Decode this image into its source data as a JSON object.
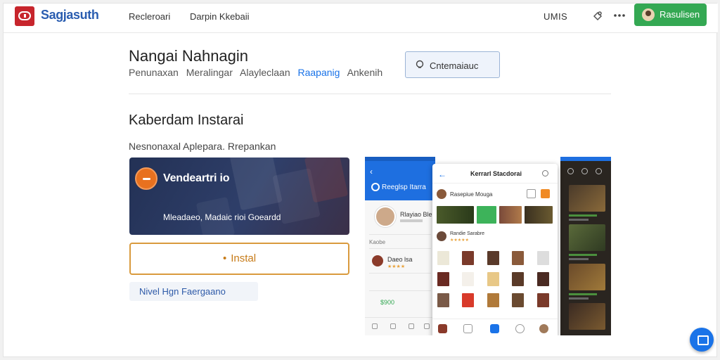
{
  "header": {
    "brand": "Sagjasuth",
    "nav": [
      "Recleroari",
      "Darpin Kkebaii"
    ],
    "units": "UMIS",
    "action_label": "Rasulisen"
  },
  "app": {
    "title": "Nangai Nahnagin",
    "breadcrumb": [
      "Penunaxan",
      "Meralingar",
      "Alayleclaan",
      "Raapanig",
      "Ankenih"
    ],
    "breadcrumb_link_index": 3,
    "wishlist_label": "Cntemaiauc"
  },
  "section": {
    "title": "Kaberdam Instarai",
    "subtitle": "Nesnonaxal Aplepara. Rrepankan",
    "video_title": "Vendeartri io",
    "video_caption": "Mleadaeo, Madaic rioi Goeardd",
    "install_label": "Instal",
    "note": "Nivel Hgn Faergaano"
  },
  "screenshots": {
    "left": {
      "subtitle": "Reeglsp Itarra",
      "profile_name": "Rlayiao Ble",
      "section_tag": "Kaobe",
      "item_title": "Daeo lsa",
      "item_rating": "★★★★",
      "price": "$900"
    },
    "center": {
      "title": "Kerrarl Stacdorai",
      "row1": "Rasepiue Mouga",
      "row2": "Randie Sarabre",
      "row2_rating": "★★★★★"
    }
  },
  "colors": {
    "brand": "#2a5db0",
    "accent_green": "#34a853",
    "install_border": "#d99a3d",
    "link": "#1a73e8"
  }
}
